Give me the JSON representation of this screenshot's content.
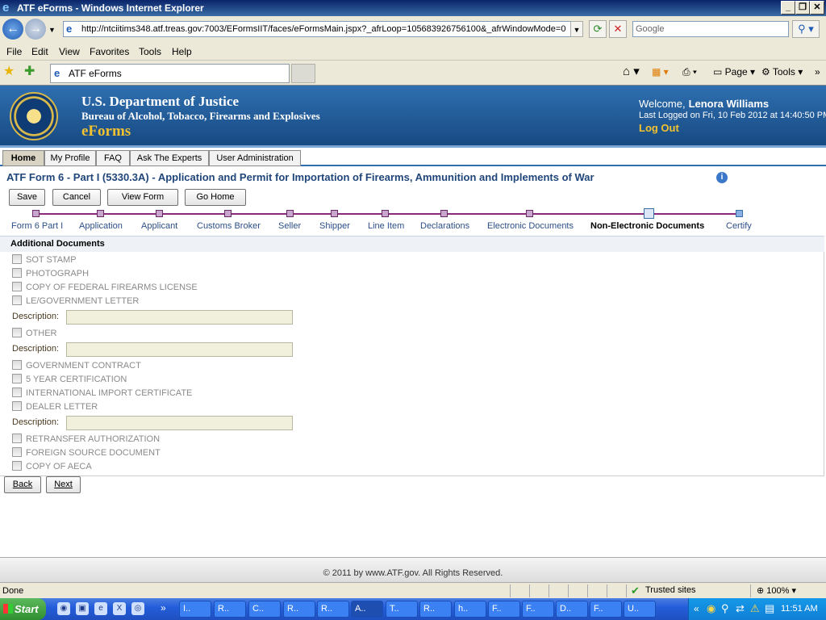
{
  "window": {
    "title": "ATF eForms - Windows Internet Explorer"
  },
  "browser": {
    "address": "http://ntciitims348.atf.treas.gov:7003/EFormsIIT/faces/eFormsMain.jspx?_afrLoop=105683926756100&_afrWindowMode=0",
    "search_placeholder": "Google",
    "menu": [
      "File",
      "Edit",
      "View",
      "Favorites",
      "Tools",
      "Help"
    ],
    "tab_title": "ATF eForms",
    "page_cmd": "Page",
    "tools_cmd": "Tools"
  },
  "banner": {
    "line1": "U.S. Department of Justice",
    "line2": "Bureau of Alcohol, Tobacco, Firearms and Explosives",
    "line3": "eForms",
    "welcome": "Welcome,",
    "user": "Lenora Williams",
    "last_logged": "Last Logged on Fri, 10 Feb 2012 at 14:40:50 PM",
    "logout": "Log Out"
  },
  "nav_tabs": [
    {
      "label": "Home"
    },
    {
      "label": "My Profile"
    },
    {
      "label": "FAQ"
    },
    {
      "label": "Ask The Experts"
    },
    {
      "label": "User Administration"
    }
  ],
  "form": {
    "title": "ATF Form 6 - Part I (5330.3A) - Application and Permit for Importation of Firearms, Ammunition and Implements of War",
    "buttons": {
      "save": "Save",
      "cancel": "Cancel",
      "view_form": "View Form",
      "go_home": "Go Home"
    },
    "train": [
      "Form 6 Part I",
      "Application",
      "Applicant",
      "Customs Broker",
      "Seller",
      "Shipper",
      "Line Item",
      "Declarations",
      "Electronic Documents",
      "Non-Electronic Documents",
      "Certify"
    ],
    "current_step": "Non-Electronic Documents",
    "section_title": "Additional Documents",
    "checkboxes": [
      "SOT STAMP",
      "PHOTOGRAPH",
      "COPY OF FEDERAL FIREARMS LICENSE",
      "LE/GOVERNMENT LETTER",
      "OTHER",
      "GOVERNMENT CONTRACT",
      "5 YEAR CERTIFICATION",
      "INTERNATIONAL IMPORT CERTIFICATE",
      "DEALER LETTER",
      "RETRANSFER AUTHORIZATION",
      "FOREIGN SOURCE DOCUMENT",
      "COPY OF AECA"
    ],
    "description_label": "Description:",
    "back": "Back",
    "next": "Next"
  },
  "footer": "© 2011 by www.ATF.gov. All Rights Reserved.",
  "status": {
    "done": "Done",
    "zone": "Trusted sites",
    "zoom": "100%"
  },
  "taskbar": {
    "start": "Start",
    "items": [
      "I..",
      "R..",
      "C..",
      "R..",
      "R..",
      "A..",
      "T..",
      "R..",
      "h..",
      "F..",
      "F..",
      "D..",
      "F..",
      "U.."
    ],
    "clock": "11:51 AM"
  }
}
